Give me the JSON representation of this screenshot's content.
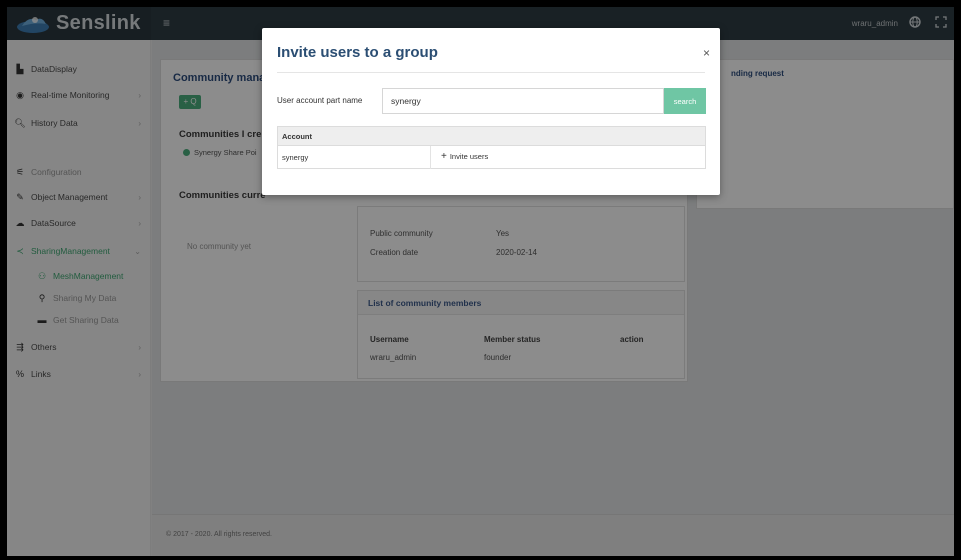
{
  "app": {
    "name": "Senslink"
  },
  "topbar": {
    "menu_icon": "hamburger-icon",
    "user": "wraru_admin",
    "globe_icon": "globe-icon",
    "expand_icon": "fullscreen-icon"
  },
  "sidebar": {
    "items": [
      {
        "label": "DataDisplay",
        "icon": "bar-chart-icon"
      },
      {
        "label": "Real-time Monitoring",
        "icon": "pulse-icon"
      },
      {
        "label": "History Data",
        "icon": "search-icon"
      },
      {
        "label": "Configuration",
        "icon": "sliders-icon"
      },
      {
        "label": "Object Management",
        "icon": "wrench-icon"
      },
      {
        "label": "DataSource",
        "icon": "cloud-icon"
      },
      {
        "label": "SharingManagement",
        "icon": "share-icon"
      },
      {
        "label": "MeshManagement",
        "icon": "people-icon"
      },
      {
        "label": "Sharing My Data",
        "icon": "share-user-icon"
      },
      {
        "label": "Get Sharing Data",
        "icon": "folder-icon"
      },
      {
        "label": "Others",
        "icon": "filter-icon"
      },
      {
        "label": "Links",
        "icon": "link-icon"
      }
    ]
  },
  "main": {
    "community_title": "Community manag",
    "add_button": "+ Q",
    "created_title": "Communities I cre",
    "created_item": "Synergy Share Poi",
    "current_title": "Communities curre",
    "no_community": "No community yet",
    "details": {
      "public_label": "Public community",
      "public_value": "Yes",
      "date_label": "Creation date",
      "date_value": "2020-02-14"
    },
    "members": {
      "title": "List of community members",
      "columns": [
        "Username",
        "Member status",
        "action"
      ],
      "rows": [
        {
          "username": "wraru_admin",
          "status": "founder",
          "action": ""
        }
      ]
    },
    "pending_title": "nding request",
    "footer": "© 2017 - 2020. All rights reserved."
  },
  "modal": {
    "title": "Invite users to a group",
    "close": "×",
    "field_label": "User account part name",
    "field_value": "synergy",
    "search_label": "search",
    "results": {
      "header": "Account",
      "rows": [
        {
          "account": "synergy",
          "action": "Invite users"
        }
      ]
    }
  },
  "colors": {
    "accent_green": "#4cb07e",
    "topbar": "#2f3d44",
    "title_blue": "#2b4e73",
    "search_button": "#6fc6a4"
  }
}
